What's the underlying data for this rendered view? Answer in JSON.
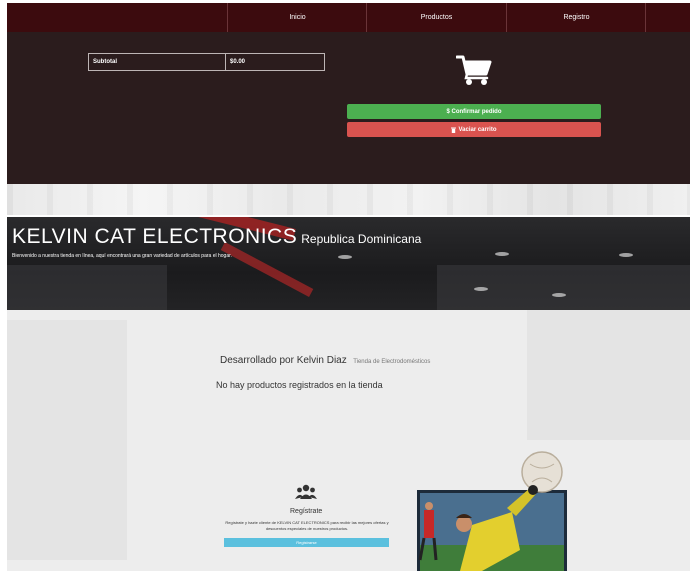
{
  "nav": {
    "items": [
      {
        "label": "Inicio"
      },
      {
        "label": "Productos"
      },
      {
        "label": "Registro"
      }
    ]
  },
  "cart": {
    "subtotal_label": "Subtotal",
    "subtotal_value": "$0.00",
    "confirm_label": "$ Confirmar pedido",
    "empty_label": "Vaciar carrito"
  },
  "hero": {
    "brand": "KELVIN CAT ELECTRONICS",
    "country": "Republica Dominicana",
    "subtitle": "Bienvenido a nuestra tienda en línea, aquí encontrará una gran variedad de artículos para el hogar."
  },
  "main": {
    "developer": "Desarrollado por Kelvin Diaz",
    "store_type": "Tienda de Electrodomésticos",
    "no_products": "No hay productos registrados en la tienda"
  },
  "register": {
    "title": "Regístrate",
    "text": "Regístrate y hazte cliente de KELVIN CAT ELECTRONICS para recibir las mejores ofertas y descuentos especiales de nuestros productos.",
    "button_label": "Registrarse"
  },
  "colors": {
    "navbar": "#3c0b0e",
    "cart_panel": "#2b1c1d",
    "confirm": "#4caf50",
    "empty": "#d9534f",
    "register_button": "#5bc0de"
  },
  "icons": [
    "cart-icon",
    "trash-icon",
    "users-icon"
  ]
}
